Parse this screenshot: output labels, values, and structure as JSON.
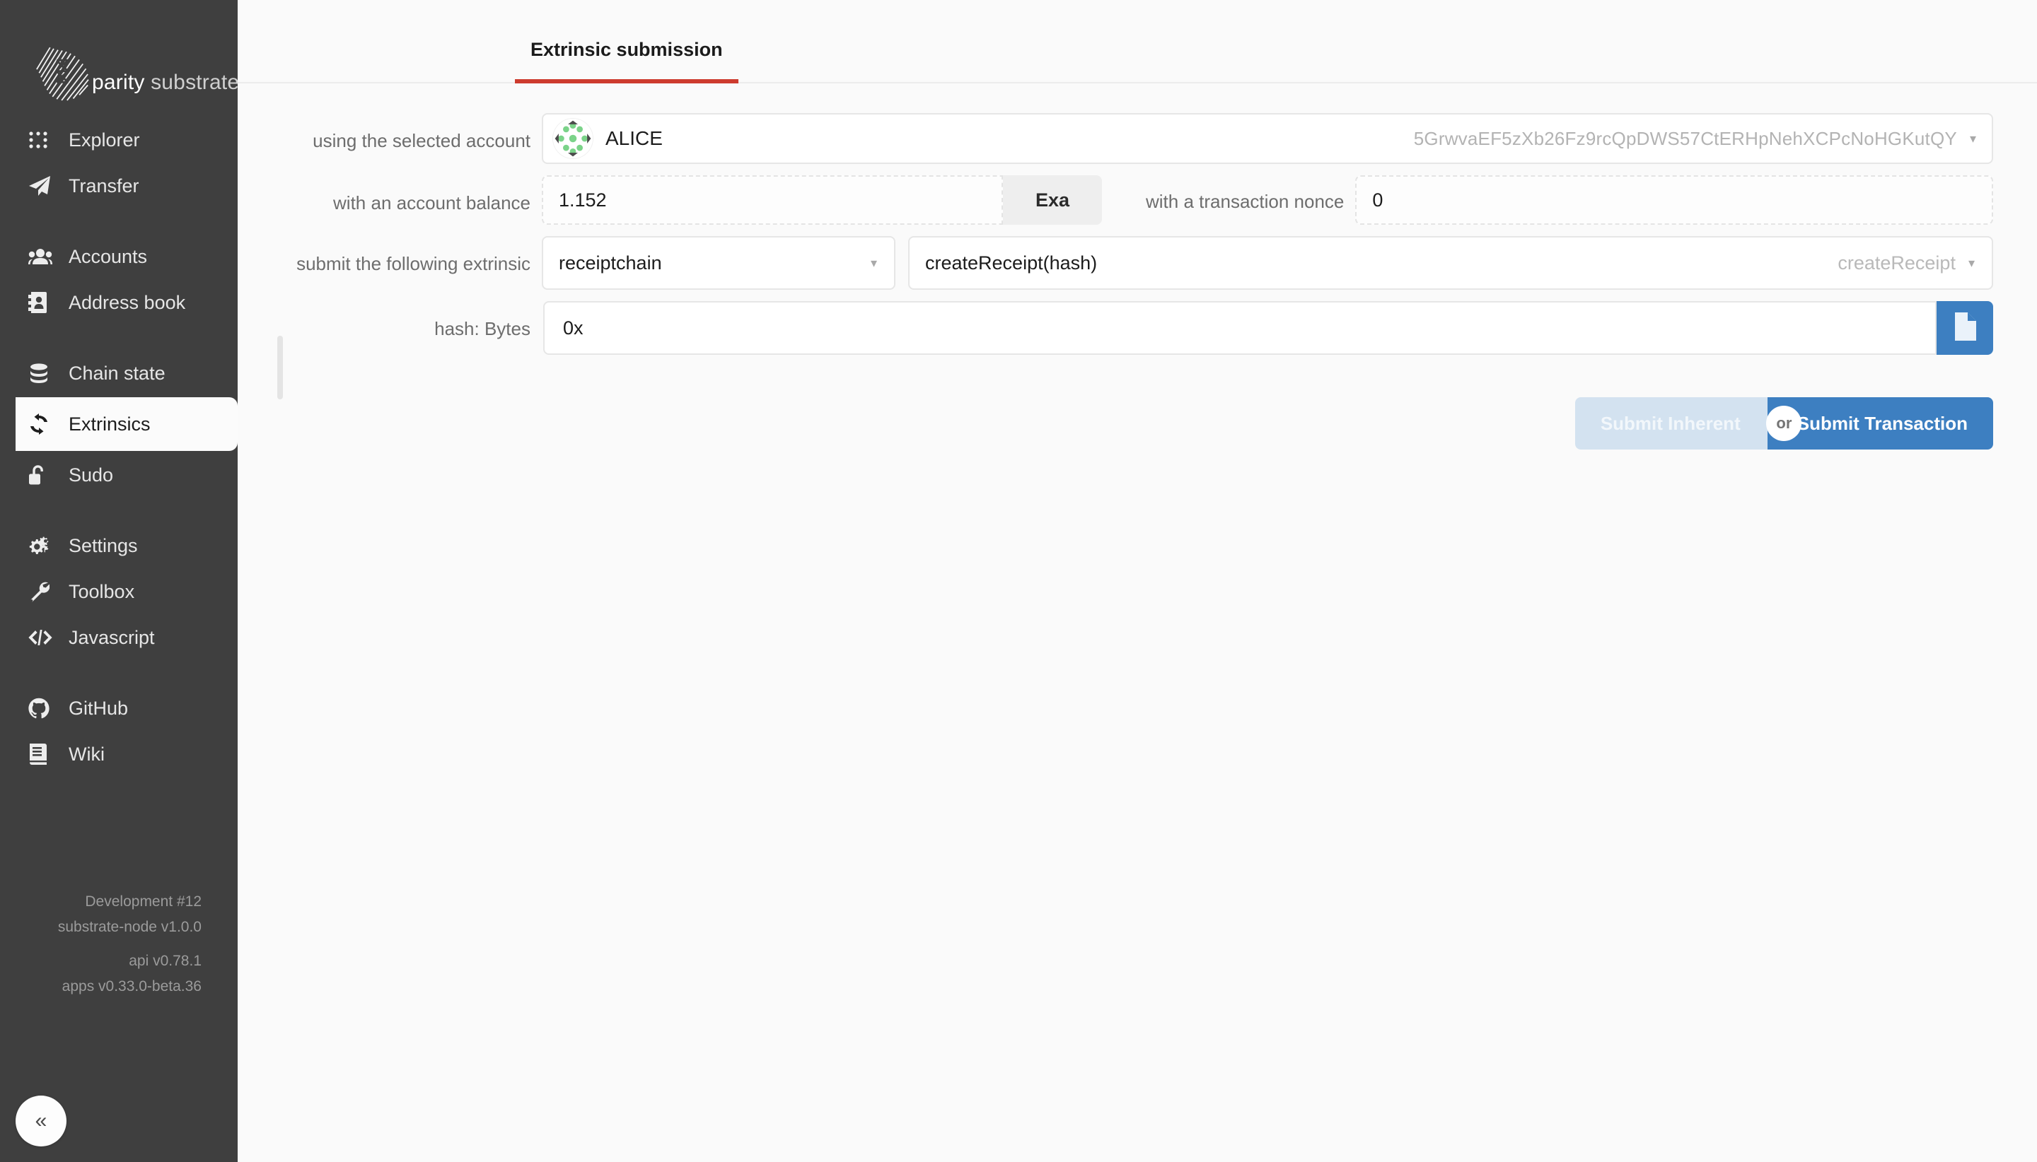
{
  "sidebar": {
    "brand": {
      "name_bold": "parity",
      "name_light": " substrate",
      "logo_icon": "parity-substrate-logo"
    },
    "items": [
      {
        "label": "Explorer",
        "icon": "explorer-dots-icon",
        "active": false
      },
      {
        "label": "Transfer",
        "icon": "paper-plane-icon",
        "active": false
      },
      {
        "label": "Accounts",
        "icon": "users-icon",
        "active": false
      },
      {
        "label": "Address book",
        "icon": "address-book-icon",
        "active": false
      },
      {
        "label": "Chain state",
        "icon": "database-icon",
        "active": false
      },
      {
        "label": "Extrinsics",
        "icon": "sync-arrows-icon",
        "active": true
      },
      {
        "label": "Sudo",
        "icon": "unlock-icon",
        "active": false
      },
      {
        "label": "Settings",
        "icon": "gears-icon",
        "active": false
      },
      {
        "label": "Toolbox",
        "icon": "wrench-icon",
        "active": false
      },
      {
        "label": "Javascript",
        "icon": "code-icon",
        "active": false
      },
      {
        "label": "GitHub",
        "icon": "github-icon",
        "active": false
      },
      {
        "label": "Wiki",
        "icon": "book-icon",
        "active": false
      }
    ],
    "versions": {
      "chain": "Development #12",
      "node": "substrate-node v1.0.0",
      "api": "api v0.78.1",
      "apps": "apps v0.33.0-beta.36"
    },
    "collapse": {
      "label": "«",
      "icon": "chevron-double-left-icon"
    }
  },
  "main": {
    "tabs": [
      {
        "label": "Extrinsic submission",
        "active": true
      }
    ],
    "account_row": {
      "label": "using the selected account",
      "name": "ALICE",
      "address": "5GrwvaEF5zXb26Fz9rcQpDWS57CtERHpNehXCPcNoHGKutQY",
      "identicon": "polkadot-identicon",
      "caret": "▾"
    },
    "balance_row": {
      "label": "with an account balance",
      "value": "1.152",
      "unit": "Exa",
      "nonce_label": "with a transaction nonce",
      "nonce_value": "0"
    },
    "extrinsic_row": {
      "label": "submit the following extrinsic",
      "section": "receiptchain",
      "method": "createReceipt(hash)",
      "method_hint": "createReceipt",
      "caret": "▾"
    },
    "hash_row": {
      "label": "hash: Bytes",
      "value": "0x",
      "file_button_icon": "file-icon"
    },
    "actions": {
      "submit_inherent": "Submit Inherent",
      "or": "or",
      "submit_transaction": "Submit Transaction"
    }
  },
  "colors": {
    "sidebar_bg": "#3f3f3f",
    "accent_red": "#cd3b2e",
    "primary_blue": "#3d7fc1",
    "disabled_blue": "#d3e2f0",
    "page_bg": "#fafafa"
  }
}
